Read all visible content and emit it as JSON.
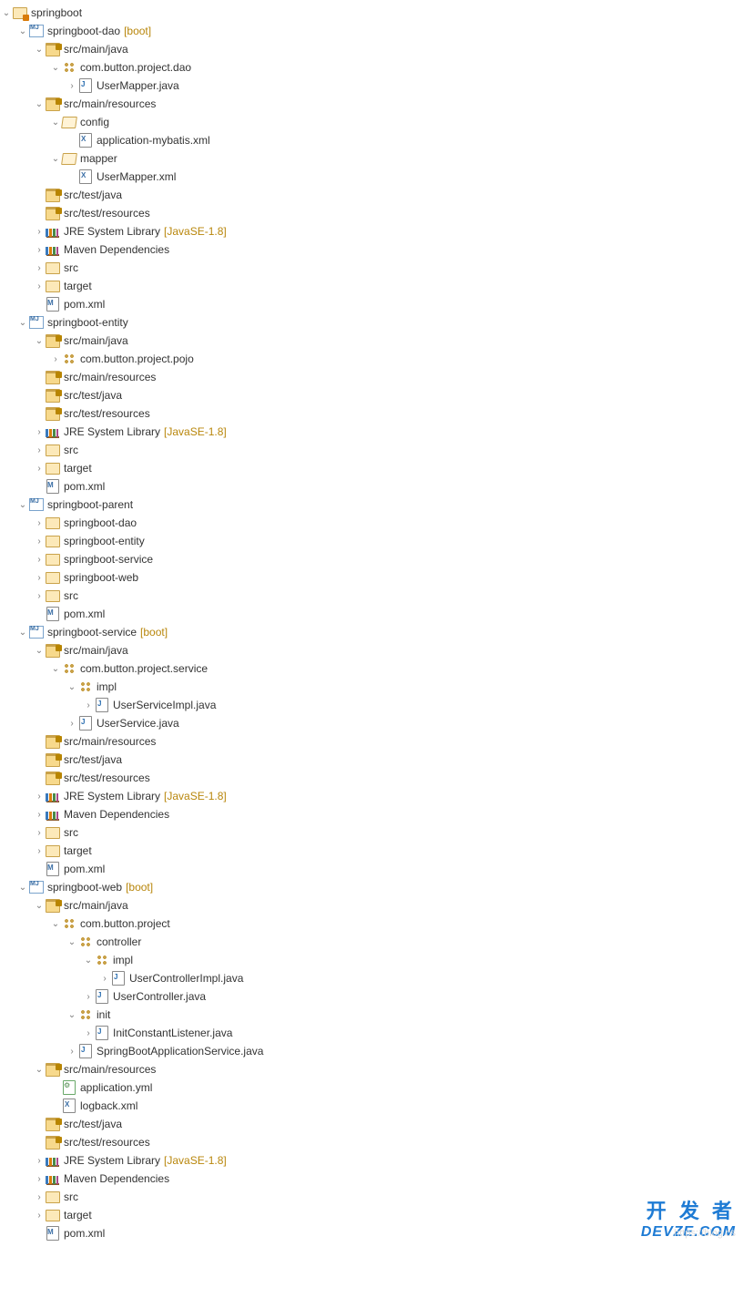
{
  "watermark": {
    "line1": "开 发 者",
    "line2": "DEVZE.COM",
    "ghost": "https://blog.cs"
  },
  "tree": [
    {
      "d": 0,
      "a": "open",
      "ic": "i-ws",
      "t": "springboot"
    },
    {
      "d": 1,
      "a": "open",
      "ic": "i-mod",
      "t": "springboot-dao",
      "dec": "[boot]"
    },
    {
      "d": 2,
      "a": "open",
      "ic": "i-srcf",
      "t": "src/main/java"
    },
    {
      "d": 3,
      "a": "open",
      "ic": "i-pkg",
      "t": "com.button.project.dao"
    },
    {
      "d": 4,
      "a": "closed",
      "ic": "i-java",
      "t": "UserMapper.java"
    },
    {
      "d": 2,
      "a": "open",
      "ic": "i-srcf",
      "t": "src/main/resources"
    },
    {
      "d": 3,
      "a": "open",
      "ic": "i-folder-open",
      "t": "config"
    },
    {
      "d": 4,
      "a": "none",
      "ic": "i-xml",
      "t": "application-mybatis.xml"
    },
    {
      "d": 3,
      "a": "open",
      "ic": "i-folder-open",
      "t": "mapper"
    },
    {
      "d": 4,
      "a": "none",
      "ic": "i-xml",
      "t": "UserMapper.xml"
    },
    {
      "d": 2,
      "a": "none",
      "ic": "i-srcf",
      "t": "src/test/java"
    },
    {
      "d": 2,
      "a": "none",
      "ic": "i-srcf",
      "t": "src/test/resources"
    },
    {
      "d": 2,
      "a": "closed",
      "ic": "i-lib",
      "t": "JRE System Library",
      "dec": "[JavaSE-1.8]"
    },
    {
      "d": 2,
      "a": "closed",
      "ic": "i-lib",
      "t": "Maven Dependencies"
    },
    {
      "d": 2,
      "a": "closed",
      "ic": "i-folder",
      "t": "src"
    },
    {
      "d": 2,
      "a": "closed",
      "ic": "i-folder",
      "t": "target"
    },
    {
      "d": 2,
      "a": "none",
      "ic": "i-m",
      "t": "pom.xml"
    },
    {
      "d": 1,
      "a": "open",
      "ic": "i-mod",
      "t": "springboot-entity"
    },
    {
      "d": 2,
      "a": "open",
      "ic": "i-srcf",
      "t": "src/main/java"
    },
    {
      "d": 3,
      "a": "closed",
      "ic": "i-pkg",
      "t": "com.button.project.pojo"
    },
    {
      "d": 2,
      "a": "none",
      "ic": "i-srcf",
      "t": "src/main/resources"
    },
    {
      "d": 2,
      "a": "none",
      "ic": "i-srcf",
      "t": "src/test/java"
    },
    {
      "d": 2,
      "a": "none",
      "ic": "i-srcf",
      "t": "src/test/resources"
    },
    {
      "d": 2,
      "a": "closed",
      "ic": "i-lib",
      "t": "JRE System Library",
      "dec": "[JavaSE-1.8]"
    },
    {
      "d": 2,
      "a": "closed",
      "ic": "i-folder",
      "t": "src"
    },
    {
      "d": 2,
      "a": "closed",
      "ic": "i-folder",
      "t": "target"
    },
    {
      "d": 2,
      "a": "none",
      "ic": "i-m",
      "t": "pom.xml"
    },
    {
      "d": 1,
      "a": "open",
      "ic": "i-mod",
      "t": "springboot-parent"
    },
    {
      "d": 2,
      "a": "closed",
      "ic": "i-folder",
      "t": "springboot-dao"
    },
    {
      "d": 2,
      "a": "closed",
      "ic": "i-folder",
      "t": "springboot-entity"
    },
    {
      "d": 2,
      "a": "closed",
      "ic": "i-folder",
      "t": "springboot-service"
    },
    {
      "d": 2,
      "a": "closed",
      "ic": "i-folder",
      "t": "springboot-web"
    },
    {
      "d": 2,
      "a": "closed",
      "ic": "i-folder",
      "t": "src"
    },
    {
      "d": 2,
      "a": "none",
      "ic": "i-m",
      "t": "pom.xml"
    },
    {
      "d": 1,
      "a": "open",
      "ic": "i-mod",
      "t": "springboot-service",
      "dec": "[boot]"
    },
    {
      "d": 2,
      "a": "open",
      "ic": "i-srcf",
      "t": "src/main/java"
    },
    {
      "d": 3,
      "a": "open",
      "ic": "i-pkg",
      "t": "com.button.project.service"
    },
    {
      "d": 4,
      "a": "open",
      "ic": "i-pkg",
      "t": "impl"
    },
    {
      "d": 5,
      "a": "closed",
      "ic": "i-java",
      "t": "UserServiceImpl.java"
    },
    {
      "d": 4,
      "a": "closed",
      "ic": "i-java",
      "t": "UserService.java"
    },
    {
      "d": 2,
      "a": "none",
      "ic": "i-srcf",
      "t": "src/main/resources"
    },
    {
      "d": 2,
      "a": "none",
      "ic": "i-srcf",
      "t": "src/test/java"
    },
    {
      "d": 2,
      "a": "none",
      "ic": "i-srcf",
      "t": "src/test/resources"
    },
    {
      "d": 2,
      "a": "closed",
      "ic": "i-lib",
      "t": "JRE System Library",
      "dec": "[JavaSE-1.8]"
    },
    {
      "d": 2,
      "a": "closed",
      "ic": "i-lib",
      "t": "Maven Dependencies"
    },
    {
      "d": 2,
      "a": "closed",
      "ic": "i-folder",
      "t": "src"
    },
    {
      "d": 2,
      "a": "closed",
      "ic": "i-folder",
      "t": "target"
    },
    {
      "d": 2,
      "a": "none",
      "ic": "i-m",
      "t": "pom.xml"
    },
    {
      "d": 1,
      "a": "open",
      "ic": "i-mod",
      "t": "springboot-web",
      "dec": "[boot]"
    },
    {
      "d": 2,
      "a": "open",
      "ic": "i-srcf",
      "t": "src/main/java"
    },
    {
      "d": 3,
      "a": "open",
      "ic": "i-pkg",
      "t": "com.button.project"
    },
    {
      "d": 4,
      "a": "open",
      "ic": "i-pkg",
      "t": "controller"
    },
    {
      "d": 5,
      "a": "open",
      "ic": "i-pkg",
      "t": "impl"
    },
    {
      "d": 6,
      "a": "closed",
      "ic": "i-java-run",
      "t": "UserControllerImpl.java"
    },
    {
      "d": 5,
      "a": "closed",
      "ic": "i-java",
      "t": "UserController.java"
    },
    {
      "d": 4,
      "a": "open",
      "ic": "i-pkg",
      "t": "init"
    },
    {
      "d": 5,
      "a": "closed",
      "ic": "i-java",
      "t": "InitConstantListener.java"
    },
    {
      "d": 4,
      "a": "closed",
      "ic": "i-java-run",
      "t": "SpringBootApplicationService.java"
    },
    {
      "d": 2,
      "a": "open",
      "ic": "i-srcf",
      "t": "src/main/resources"
    },
    {
      "d": 3,
      "a": "none",
      "ic": "i-yaml",
      "t": "application.yml"
    },
    {
      "d": 3,
      "a": "none",
      "ic": "i-xml",
      "t": "logback.xml"
    },
    {
      "d": 2,
      "a": "none",
      "ic": "i-srcf",
      "t": "src/test/java"
    },
    {
      "d": 2,
      "a": "none",
      "ic": "i-srcf",
      "t": "src/test/resources"
    },
    {
      "d": 2,
      "a": "closed",
      "ic": "i-lib",
      "t": "JRE System Library",
      "dec": "[JavaSE-1.8]"
    },
    {
      "d": 2,
      "a": "closed",
      "ic": "i-lib",
      "t": "Maven Dependencies"
    },
    {
      "d": 2,
      "a": "closed",
      "ic": "i-folder",
      "t": "src"
    },
    {
      "d": 2,
      "a": "closed",
      "ic": "i-folder",
      "t": "target"
    },
    {
      "d": 2,
      "a": "none",
      "ic": "i-m",
      "t": "pom.xml"
    }
  ]
}
